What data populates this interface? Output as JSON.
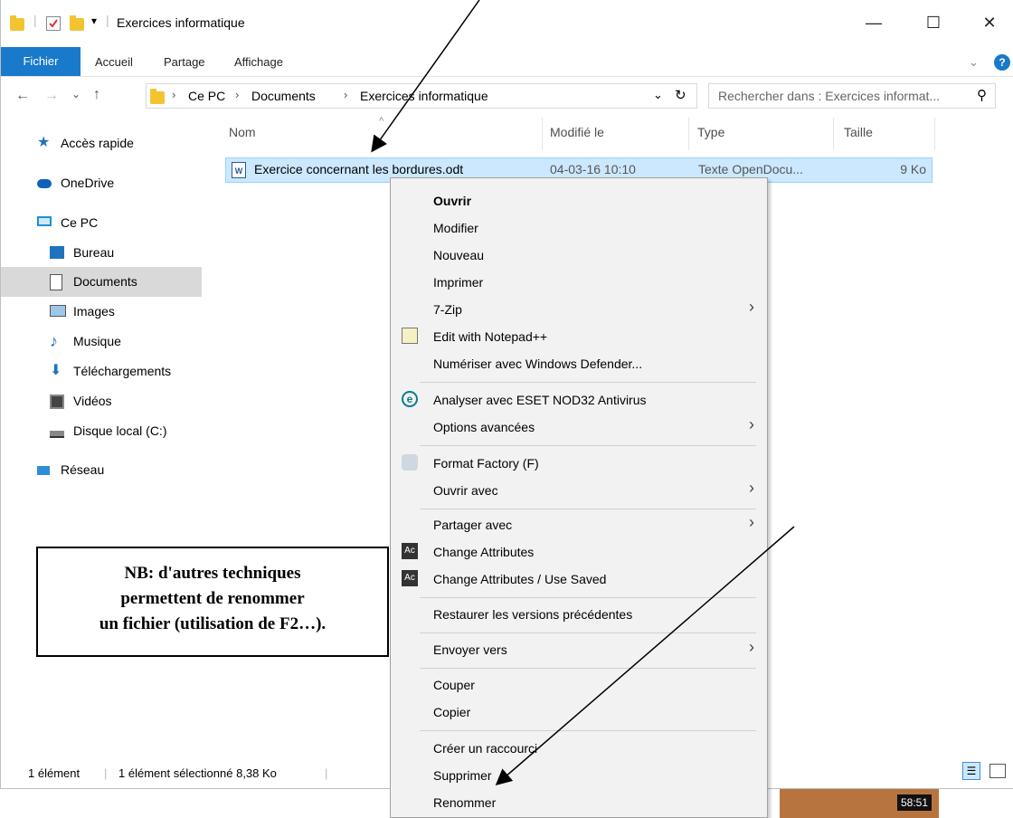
{
  "window": {
    "title": "Exercices informatique"
  },
  "window_controls": {
    "minimize": "—",
    "maximize": "☐",
    "close": "✕"
  },
  "ribbon": {
    "file": "Fichier",
    "tabs": [
      "Accueil",
      "Partage",
      "Affichage"
    ]
  },
  "address": {
    "breadcrumb": [
      "Ce PC",
      "Documents",
      "Exercices informatique"
    ],
    "search_placeholder": "Rechercher dans : Exercices informat..."
  },
  "nav": {
    "items": [
      {
        "label": "Accès rapide",
        "icon": "star-icon"
      },
      {
        "label": "OneDrive",
        "icon": "cloud-icon"
      },
      {
        "label": "Ce PC",
        "icon": "computer-icon"
      },
      {
        "label": "Bureau",
        "icon": "desktop-icon"
      },
      {
        "label": "Documents",
        "icon": "documents-icon"
      },
      {
        "label": "Images",
        "icon": "images-icon"
      },
      {
        "label": "Musique",
        "icon": "music-icon"
      },
      {
        "label": "Téléchargements",
        "icon": "download-icon"
      },
      {
        "label": "Vidéos",
        "icon": "videos-icon"
      },
      {
        "label": "Disque local (C:)",
        "icon": "drive-icon"
      },
      {
        "label": "Réseau",
        "icon": "network-icon"
      }
    ]
  },
  "columns": {
    "name": "Nom",
    "modified": "Modifié le",
    "type": "Type",
    "size": "Taille"
  },
  "file": {
    "name": "Exercice concernant les bordures.odt",
    "modified": "04-03-16 10:10",
    "type": "Texte OpenDocu...",
    "size": "9 Ko"
  },
  "context_menu": {
    "items": [
      "Ouvrir",
      "Modifier",
      "Nouveau",
      "Imprimer",
      "7-Zip",
      "Edit with Notepad++",
      "Numériser avec Windows Defender...",
      "Analyser avec ESET NOD32 Antivirus",
      "Options avancées",
      "Format Factory (F)",
      "Ouvrir avec",
      "Partager avec",
      "Change Attributes",
      "Change Attributes / Use Saved",
      "Restaurer les versions précédentes",
      "Envoyer vers",
      "Couper",
      "Copier",
      "Créer un raccourci",
      "Supprimer",
      "Renommer"
    ]
  },
  "status": {
    "count": "1 élément",
    "selection": "1 élément sélectionné 8,38 Ko"
  },
  "note": {
    "line1": "NB: d'autres techniques",
    "line2": "permettent de renommer",
    "line3": "un fichier (utilisation de F2…)."
  },
  "video_time": "58:51",
  "colors": {
    "accent": "#1979ca",
    "selection": "#cce8ff",
    "selected_nav": "#d9d9d9"
  }
}
